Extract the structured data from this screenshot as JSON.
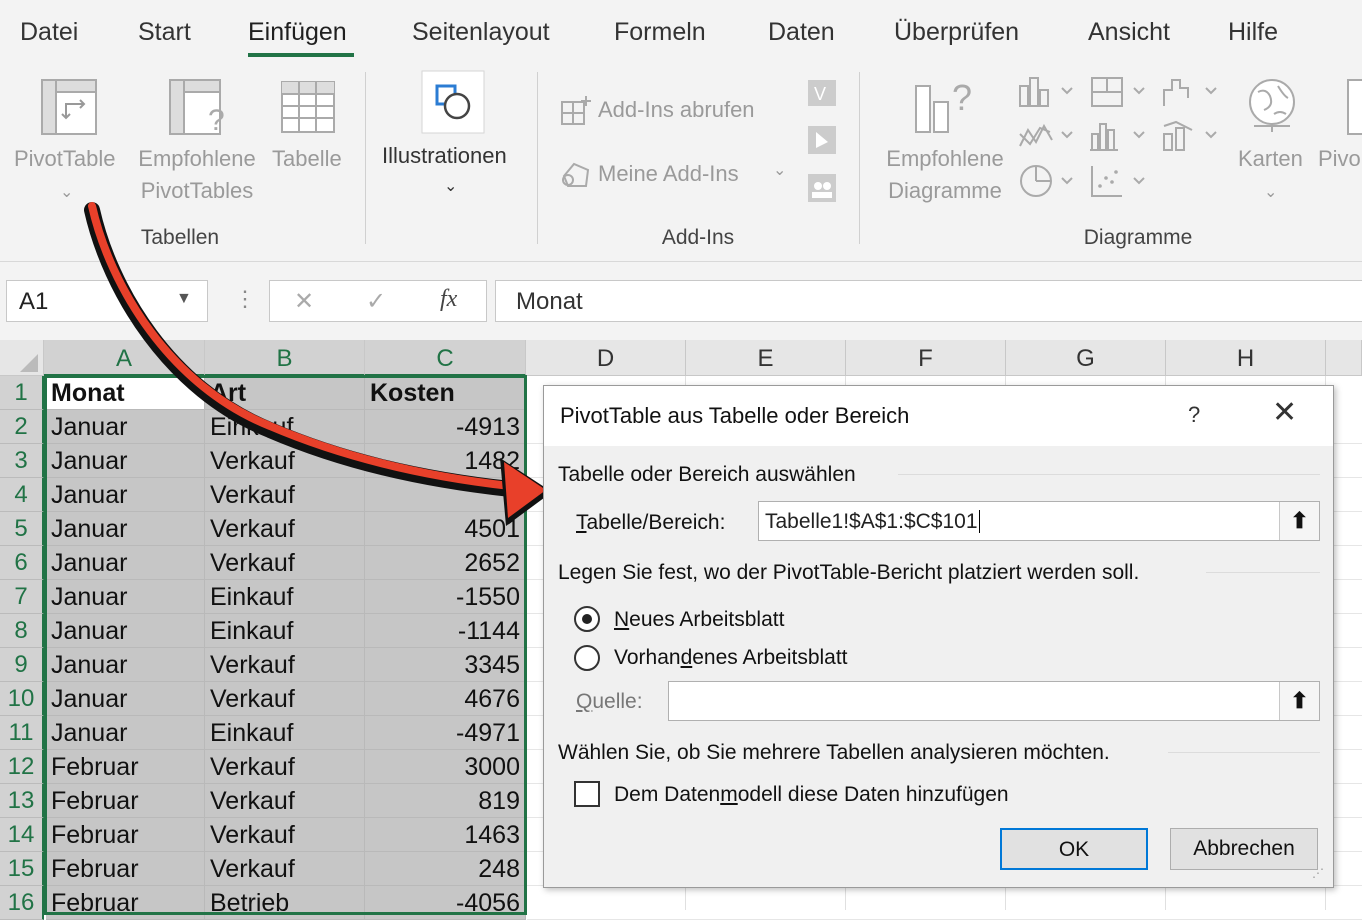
{
  "ribbon": {
    "tabs": [
      "Datei",
      "Start",
      "Einfügen",
      "Seitenlayout",
      "Formeln",
      "Daten",
      "Überprüfen",
      "Ansicht",
      "Hilfe"
    ],
    "active_tab": "Einfügen",
    "groups": {
      "tabellen": {
        "label": "Tabellen",
        "pivottable": "PivotTable",
        "empfohlene_1": "Empfohlene",
        "empfohlene_2": "PivotTables",
        "tabelle": "Tabelle"
      },
      "illustrationen": {
        "label": "Illustrationen"
      },
      "addins": {
        "label": "Add-Ins",
        "abrufen": "Add-Ins abrufen",
        "meine": "Meine Add-Ins"
      },
      "diagramme": {
        "label": "Diagramme",
        "empfohlene_1": "Empfohlene",
        "empfohlene_2": "Diagramme",
        "karten": "Karten",
        "pivot": "Pivo"
      }
    }
  },
  "formula_bar": {
    "name_box": "A1",
    "fx": "fx",
    "cancel": "✕",
    "confirm": "✓",
    "value": "Monat"
  },
  "sheet": {
    "columns": [
      "A",
      "B",
      "C",
      "D",
      "E",
      "F",
      "G",
      "H"
    ],
    "header": [
      "Monat",
      "Art",
      "Kosten"
    ],
    "rows": [
      {
        "n": "2",
        "monat": "Januar",
        "art": "Einkauf",
        "kosten": "-4913"
      },
      {
        "n": "3",
        "monat": "Januar",
        "art": "Verkauf",
        "kosten": "1482"
      },
      {
        "n": "4",
        "monat": "Januar",
        "art": "Verkauf",
        "kosten": ""
      },
      {
        "n": "5",
        "monat": "Januar",
        "art": "Verkauf",
        "kosten": "4501"
      },
      {
        "n": "6",
        "monat": "Januar",
        "art": "Verkauf",
        "kosten": "2652"
      },
      {
        "n": "7",
        "monat": "Januar",
        "art": "Einkauf",
        "kosten": "-1550"
      },
      {
        "n": "8",
        "monat": "Januar",
        "art": "Einkauf",
        "kosten": "-1144"
      },
      {
        "n": "9",
        "monat": "Januar",
        "art": "Verkauf",
        "kosten": "3345"
      },
      {
        "n": "10",
        "monat": "Januar",
        "art": "Verkauf",
        "kosten": "4676"
      },
      {
        "n": "11",
        "monat": "Januar",
        "art": "Einkauf",
        "kosten": "-4971"
      },
      {
        "n": "12",
        "monat": "Februar",
        "art": "Verkauf",
        "kosten": "3000"
      },
      {
        "n": "13",
        "monat": "Februar",
        "art": "Verkauf",
        "kosten": "819"
      },
      {
        "n": "14",
        "monat": "Februar",
        "art": "Verkauf",
        "kosten": "1463"
      },
      {
        "n": "15",
        "monat": "Februar",
        "art": "Verkauf",
        "kosten": "248"
      },
      {
        "n": "16",
        "monat": "Februar",
        "art": "Betrieb",
        "kosten": "-4056"
      }
    ],
    "row1": "1"
  },
  "dialog": {
    "title": "PivotTable aus Tabelle oder Bereich",
    "help": "?",
    "close": "✕",
    "section1": "Tabelle oder Bereich auswählen",
    "range_label_u": "T",
    "range_label_rest": "abelle/Bereich:",
    "range_value": "Tabelle1!$A$1:$C$101",
    "section2": "Legen Sie fest, wo der PivotTable-Bericht platziert werden soll.",
    "opt_new_u": "N",
    "opt_new_rest": "eues Arbeitsblatt",
    "opt_existing_a": "Vorhan",
    "opt_existing_u": "d",
    "opt_existing_b": "enes Arbeitsblatt",
    "source_label_u": "Q",
    "source_label_rest": "uelle:",
    "source_value": "",
    "section3": "Wählen Sie, ob Sie mehrere Tabellen analysieren möchten.",
    "datamodel_a": "Dem Daten",
    "datamodel_u": "m",
    "datamodel_b": "odell diese Daten hinzufügen",
    "ok": "OK",
    "cancel": "Abbrechen",
    "upload_icon": "⬆"
  },
  "colors": {
    "accent": "#217346",
    "arrow_red": "#e8402a",
    "arrow_black": "#111111",
    "selection_gray": "#c6c6c6",
    "ok_border": "#0078d7"
  }
}
